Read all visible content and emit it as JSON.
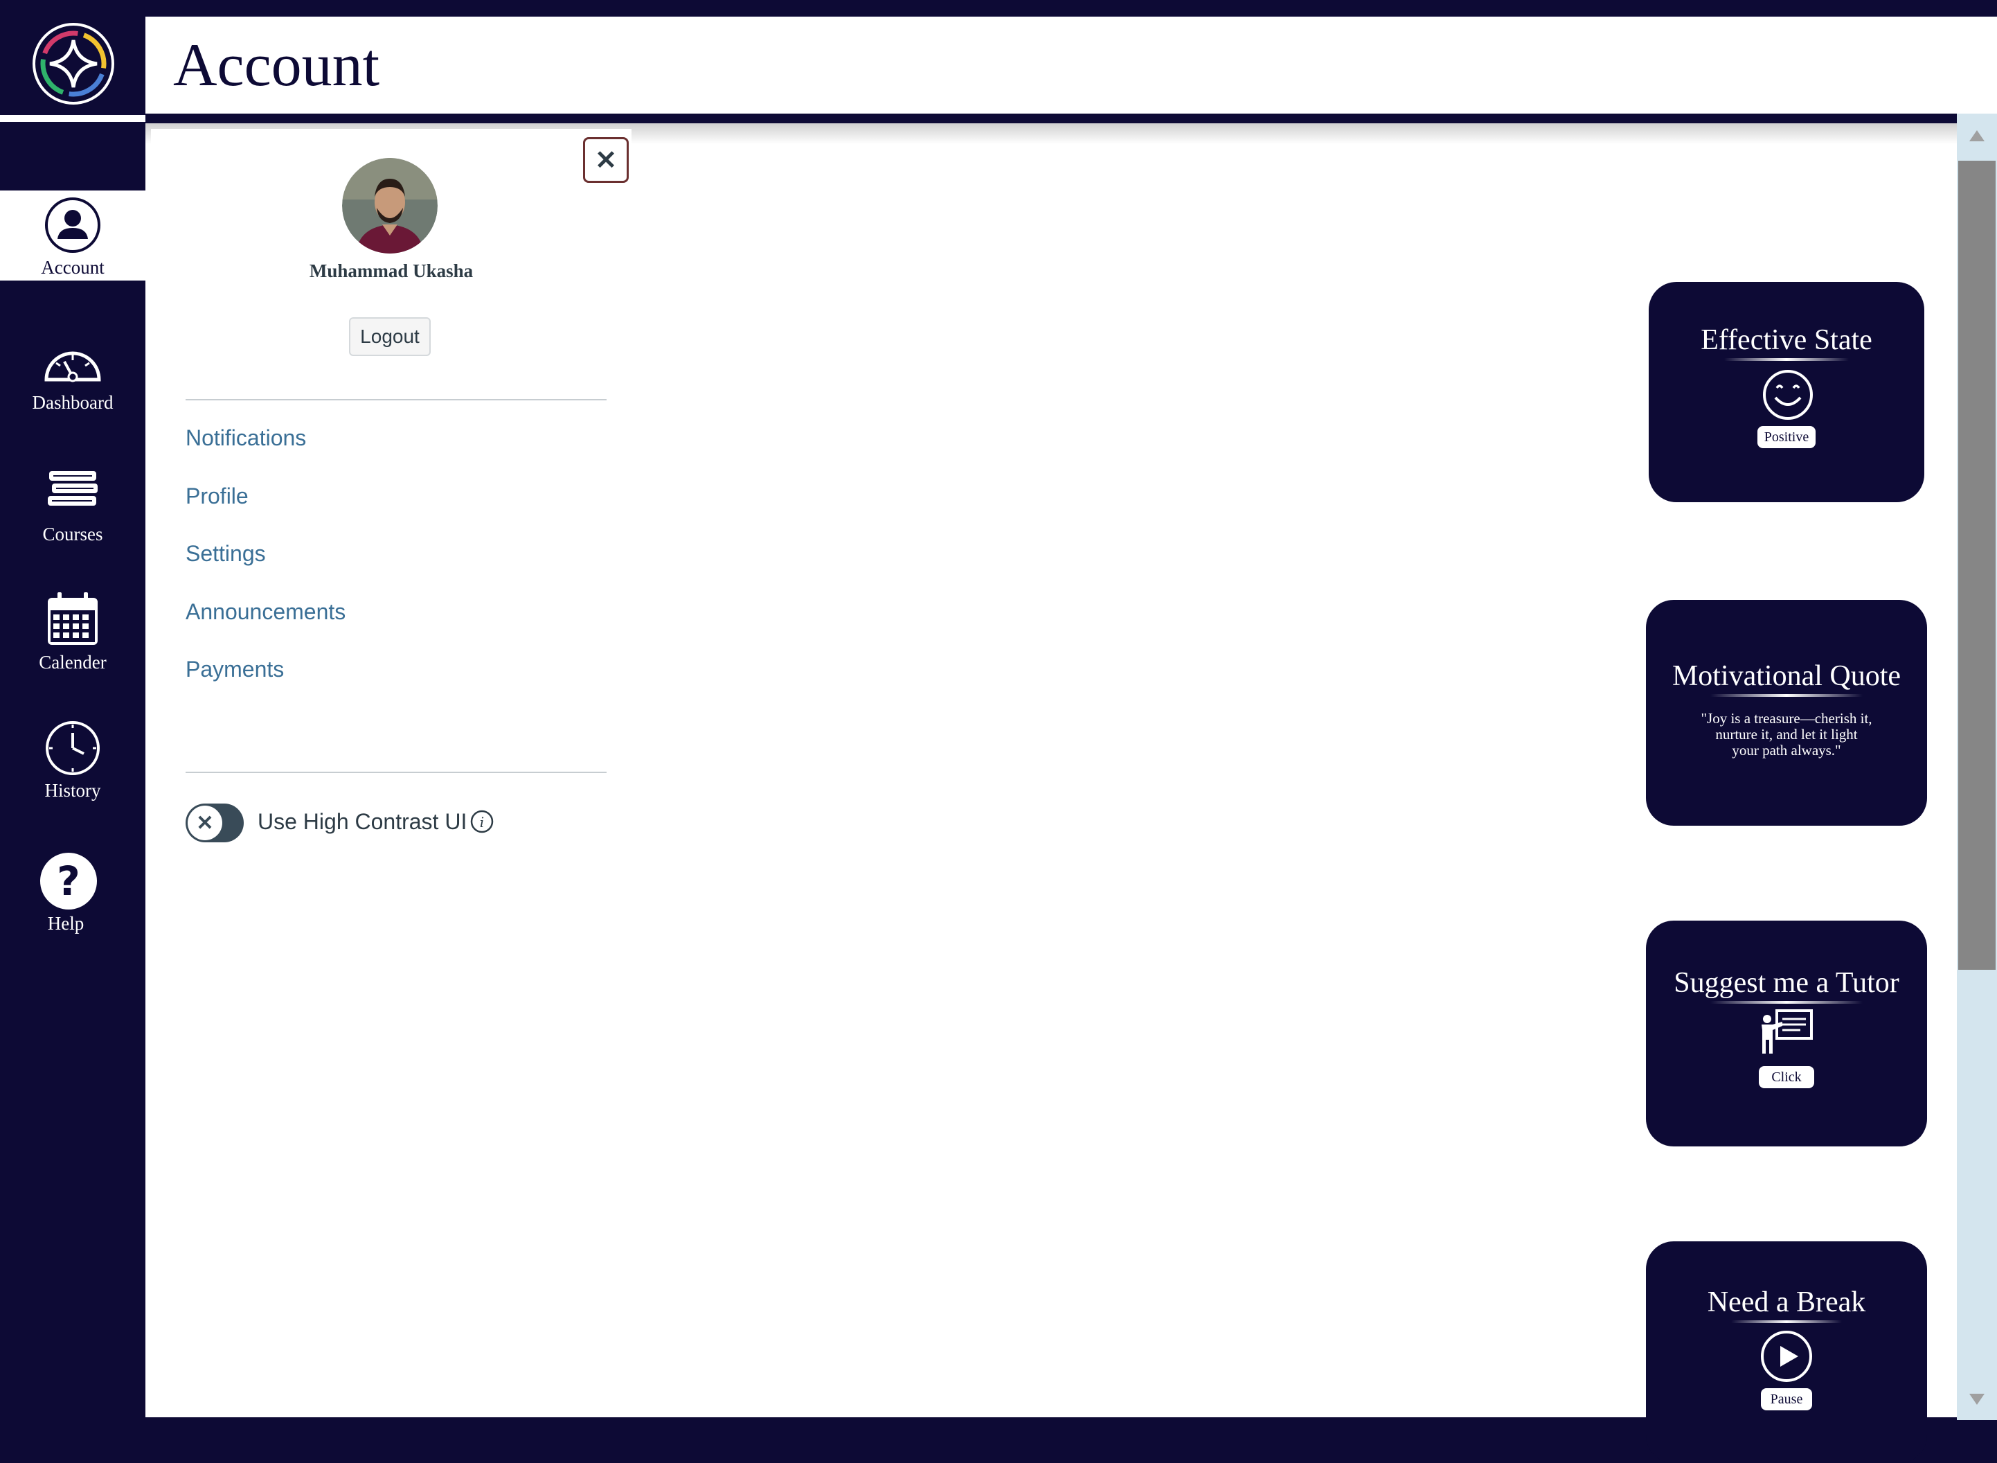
{
  "header": {
    "title": "Account"
  },
  "sidebar": {
    "items": [
      {
        "label": "Account",
        "icon": "user-icon",
        "active": true
      },
      {
        "label": "Dashboard",
        "icon": "gauge-icon",
        "active": false
      },
      {
        "label": "Courses",
        "icon": "books-icon",
        "active": false
      },
      {
        "label": "Calender",
        "icon": "calendar-icon",
        "active": false
      },
      {
        "label": "History",
        "icon": "clock-icon",
        "active": false
      },
      {
        "label": "Help",
        "icon": "question-icon",
        "active": false
      }
    ]
  },
  "tray": {
    "user_name": "Muhammad Ukasha",
    "logout_label": "Logout",
    "links": [
      "Notifications",
      "Profile",
      "Settings",
      "Announcements",
      "Payments"
    ],
    "high_contrast_label": "Use High Contrast UI",
    "high_contrast_enabled": false
  },
  "cards": {
    "effective_state": {
      "title": "Effective State",
      "button": "Positive",
      "icon": "smiley-icon"
    },
    "motivational_quote": {
      "title": "Motivational Quote",
      "line1": "\"Joy is a treasure—cherish it,",
      "line2": "nurture it, and let it light",
      "line3": "your path always.\""
    },
    "tutor": {
      "title": "Suggest me a Tutor",
      "button": "Click",
      "icon": "teacher-board-icon"
    },
    "break": {
      "title": "Need a Break",
      "button": "Pause",
      "icon": "play-icon"
    }
  },
  "colors": {
    "navy": "#0d0a35",
    "link": "#3a6f96",
    "text": "#2d3b45"
  }
}
